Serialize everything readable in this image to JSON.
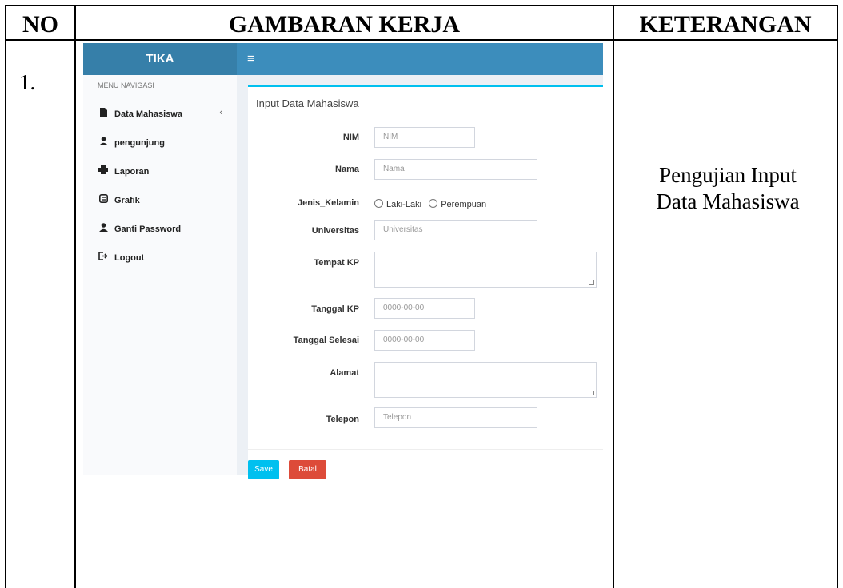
{
  "table": {
    "headers": {
      "no": "NO",
      "gambaran": "GAMBARAN KERJA",
      "keterangan": "KETERANGAN"
    },
    "row": {
      "no": "1.",
      "keterangan_line1": "Pengujian Input",
      "keterangan_line2": "Data Mahasiswa"
    }
  },
  "app": {
    "logo": "TIKA",
    "menu_toggle": "≡",
    "sidebar": {
      "heading": "MENU NAVIGASI",
      "items": [
        {
          "label": "Data Mahasiswa",
          "icon": "file-icon",
          "chevron": "‹"
        },
        {
          "label": "pengunjung",
          "icon": "user-icon"
        },
        {
          "label": "Laporan",
          "icon": "print-icon"
        },
        {
          "label": "Grafik",
          "icon": "chart-box-icon"
        },
        {
          "label": "Ganti Password",
          "icon": "user-icon"
        },
        {
          "label": "Logout",
          "icon": "logout-icon"
        }
      ]
    },
    "form": {
      "title": "Input Data Mahasiswa",
      "fields": {
        "nim": {
          "label": "NIM",
          "placeholder": "NIM"
        },
        "nama": {
          "label": "Nama",
          "placeholder": "Nama"
        },
        "jenis_kelamin": {
          "label": "Jenis_Kelamin",
          "options": [
            "Laki-Laki",
            "Perempuan"
          ]
        },
        "universitas": {
          "label": "Universitas",
          "placeholder": "Universitas"
        },
        "tempat_kp": {
          "label": "Tempat KP"
        },
        "tanggal_kp": {
          "label": "Tanggal KP",
          "placeholder": "0000-00-00"
        },
        "tanggal_selesai": {
          "label": "Tanggal Selesai",
          "placeholder": "0000-00-00"
        },
        "alamat": {
          "label": "Alamat"
        },
        "telepon": {
          "label": "Telepon",
          "placeholder": "Telepon"
        }
      },
      "buttons": {
        "save": "Save",
        "batal": "Batal"
      }
    },
    "colors": {
      "header": "#3c8dbc",
      "box_accent": "#00c0ef",
      "save": "#00c0ef",
      "batal": "#dd4b39"
    }
  }
}
